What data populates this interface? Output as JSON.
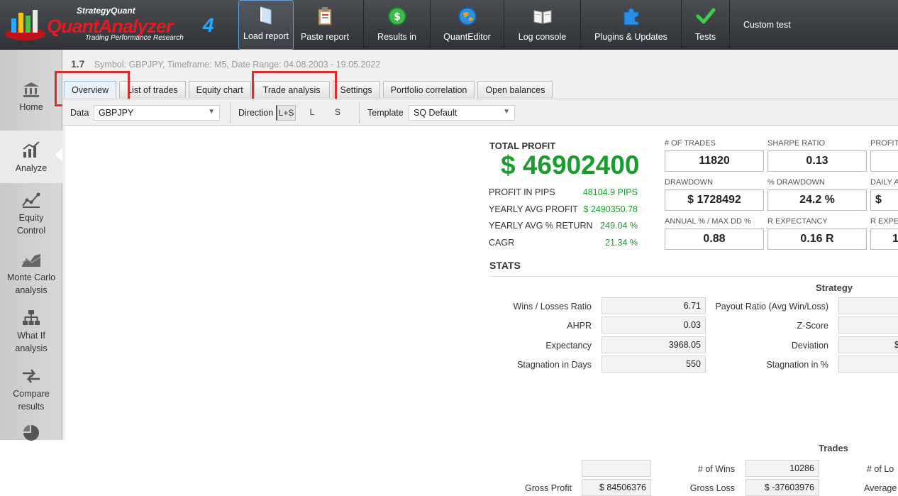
{
  "app": {
    "brand": "StrategyQuant",
    "name": "QuantAnalyzer",
    "version": "4",
    "tagline": "Trading Performance   Research"
  },
  "toolbar": {
    "buttons": [
      {
        "label": "Load report",
        "icon": "folder-icon"
      },
      {
        "label": "Paste report",
        "icon": "clipboard-icon"
      },
      {
        "label": "Results in",
        "icon": "dollar-coin-icon"
      },
      {
        "label": "QuantEditor",
        "icon": "globe-icon"
      },
      {
        "label": "Log console",
        "icon": "book-icon"
      },
      {
        "label": "Plugins & Updates",
        "icon": "puzzle-icon"
      },
      {
        "label": "Tests",
        "icon": "checkmark-icon"
      }
    ],
    "custom_test": "Custom test"
  },
  "sidebar": {
    "items": [
      {
        "label": "Home",
        "icon": "bank-icon"
      },
      {
        "label": "Analyze",
        "icon": "trend-chart-icon"
      },
      {
        "label": "Equity Control",
        "icon": "equity-curve-icon"
      },
      {
        "label": "Monte Carlo analysis",
        "icon": "monte-carlo-icon"
      },
      {
        "label": "What If analysis",
        "icon": "hierarchy-icon"
      },
      {
        "label": "Compare results",
        "icon": "compare-arrows-icon"
      },
      {
        "label": "",
        "icon": "pie-chart-icon"
      }
    ]
  },
  "header": {
    "version": "1.7",
    "info": "Symbol: GBPJPY, Timeframe: M5, Date Range: 04.08.2003 - 19.05.2022"
  },
  "tabs": [
    "Overview",
    "List of trades",
    "Equity chart",
    "Trade analysis",
    "Settings",
    "Portfolio correlation",
    "Open balances"
  ],
  "filters": {
    "data_label": "Data",
    "data_value": "GBPJPY",
    "direction_label": "Direction",
    "direction_options": [
      "L+S",
      "L",
      "S"
    ],
    "template_label": "Template",
    "template_value": "SQ Default"
  },
  "overview": {
    "total_profit_label": "TOTAL PROFIT",
    "total_profit_value": "$ 46902400",
    "kv": [
      {
        "label": "PROFIT IN PIPS",
        "value": "48104.9 PIPS"
      },
      {
        "label": "YEARLY AVG PROFIT",
        "value": "$ 2490350.78"
      },
      {
        "label": "YEARLY AVG % RETURN",
        "value": "249.04 %"
      },
      {
        "label": "CAGR",
        "value": "21.34 %"
      }
    ],
    "metrics": [
      {
        "label": "# OF TRADES",
        "value": "11820"
      },
      {
        "label": "SHARPE RATIO",
        "value": "0.13"
      },
      {
        "label": "PROFIT",
        "value": ""
      },
      {
        "label": "DRAWDOWN",
        "value": "$ 1728492"
      },
      {
        "label": "% DRAWDOWN",
        "value": "24.2 %"
      },
      {
        "label": "DAILY A",
        "value": "$"
      },
      {
        "label": "ANNUAL % / MAX DD %",
        "value": "0.88"
      },
      {
        "label": "R EXPECTANCY",
        "value": "0.16 R"
      },
      {
        "label": "R EXPE",
        "value": "1"
      }
    ]
  },
  "stats": {
    "title": "STATS",
    "strategy_title": "Strategy",
    "left_rows": [
      {
        "label": "Wins / Losses Ratio",
        "value": "6.71"
      },
      {
        "label": "AHPR",
        "value": "0.03"
      },
      {
        "label": "Expectancy",
        "value": "3968.05"
      },
      {
        "label": "Stagnation in Days",
        "value": "550"
      }
    ],
    "right_rows": [
      {
        "label": "Payout Ratio (Avg Win/Loss)",
        "value": ""
      },
      {
        "label": "Z-Score",
        "value": ""
      },
      {
        "label": "Deviation",
        "value": "$"
      },
      {
        "label": "Stagnation in %",
        "value": ""
      }
    ],
    "trades_title": "Trades",
    "trades": {
      "wins_label": "# of Wins",
      "wins_value": "10286",
      "losses_label": "# of Lo",
      "gross_profit_label": "Gross Profit",
      "gross_profit_value": "$ 84506376",
      "gross_loss_label": "Gross Loss",
      "gross_loss_value": "$ -37603976",
      "average_label": "Average"
    }
  }
}
